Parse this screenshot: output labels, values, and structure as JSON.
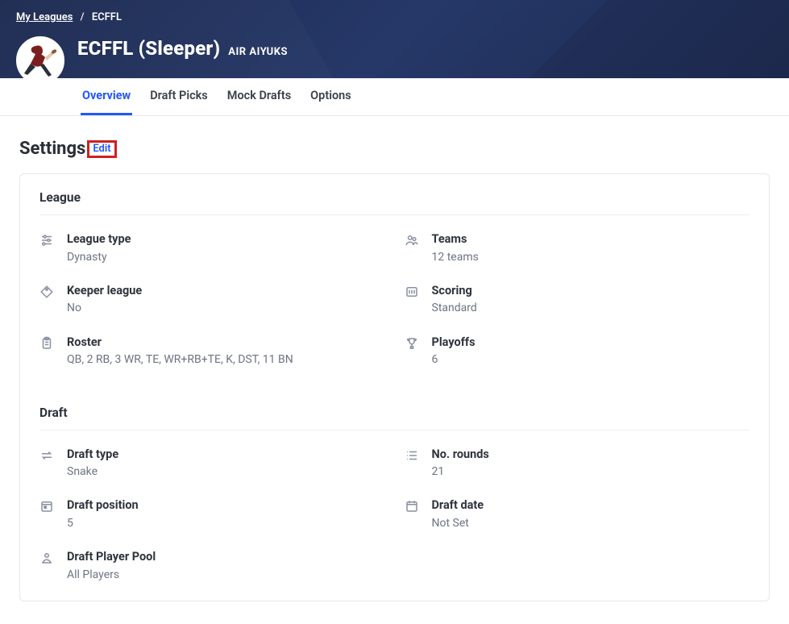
{
  "breadcrumb": {
    "root": "My Leagues",
    "current": "ECFFL"
  },
  "header": {
    "league_title": "ECFFL (Sleeper)",
    "team_name": "AIR AIYUKS"
  },
  "tabs": [
    {
      "label": "Overview",
      "active": true
    },
    {
      "label": "Draft Picks",
      "active": false
    },
    {
      "label": "Mock Drafts",
      "active": false
    },
    {
      "label": "Options",
      "active": false
    }
  ],
  "settings": {
    "title": "Settings",
    "edit_label": "Edit",
    "league_section": {
      "title": "League",
      "items": {
        "league_type": {
          "label": "League type",
          "value": "Dynasty"
        },
        "teams": {
          "label": "Teams",
          "value": "12 teams"
        },
        "keeper": {
          "label": "Keeper league",
          "value": "No"
        },
        "scoring": {
          "label": "Scoring",
          "value": "Standard"
        },
        "roster": {
          "label": "Roster",
          "value": "QB, 2 RB, 3 WR, TE, WR+RB+TE, K, DST, 11 BN"
        },
        "playoffs": {
          "label": "Playoffs",
          "value": "6"
        }
      }
    },
    "draft_section": {
      "title": "Draft",
      "items": {
        "draft_type": {
          "label": "Draft type",
          "value": "Snake"
        },
        "no_rounds": {
          "label": "No. rounds",
          "value": "21"
        },
        "draft_position": {
          "label": "Draft position",
          "value": "5"
        },
        "draft_date": {
          "label": "Draft date",
          "value": "Not Set"
        },
        "player_pool": {
          "label": "Draft Player Pool",
          "value": "All Players"
        }
      }
    }
  }
}
